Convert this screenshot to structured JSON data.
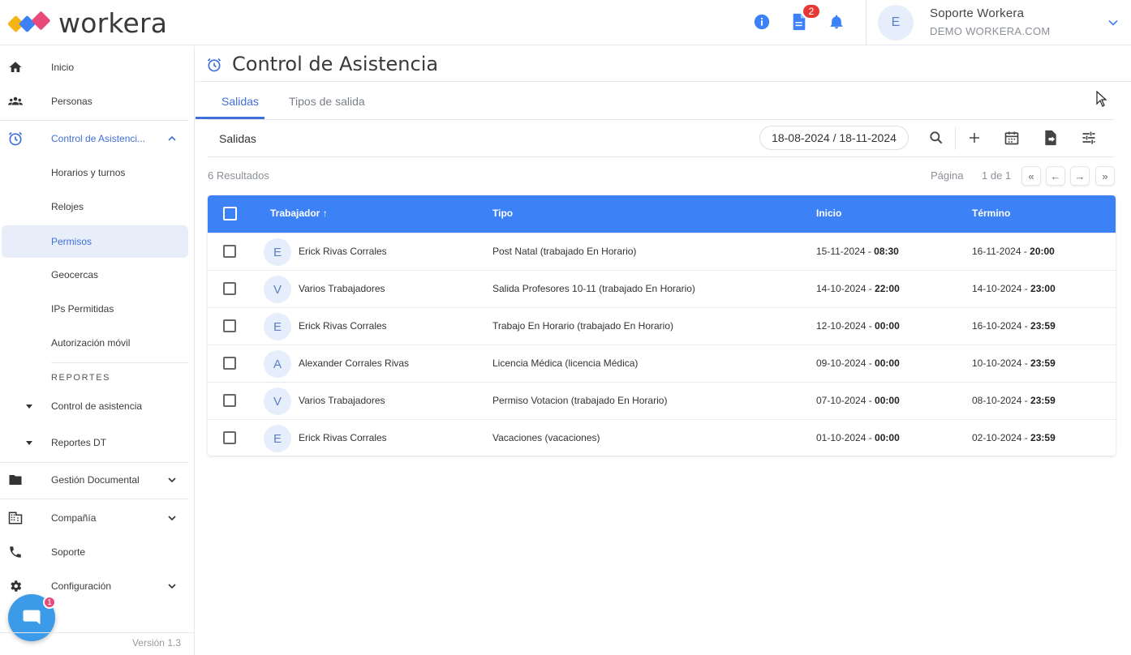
{
  "app": {
    "logo_text": "workera",
    "brand_colors": [
      "#e84a7a",
      "#f5b316",
      "#3c82f6"
    ],
    "notification_count": "2"
  },
  "user": {
    "avatar_letter": "E",
    "name": "Soporte Workera",
    "company": "DEMO WORKERA.COM"
  },
  "sidebar": {
    "items": [
      {
        "label": "Inicio",
        "icon": "home-icon"
      },
      {
        "label": "Personas",
        "icon": "people-icon"
      },
      {
        "label": "Control de Asistenci...",
        "icon": "alarm-clock-icon"
      },
      {
        "label": "Horarios y turnos"
      },
      {
        "label": "Relojes"
      },
      {
        "label": "Permisos"
      },
      {
        "label": "Geocercas"
      },
      {
        "label": "IPs Permitidas"
      },
      {
        "label": "Autorización móvil"
      },
      {
        "label": "Control de asistencia"
      },
      {
        "label": "Reportes DT"
      },
      {
        "label": "Gestión Documental",
        "icon": "folder-icon"
      },
      {
        "label": "Compañía",
        "icon": "building-icon"
      },
      {
        "label": "Soporte",
        "icon": "phone-icon"
      },
      {
        "label": "Configuración",
        "icon": "gear-icon"
      }
    ],
    "reports_title": "REPORTES",
    "version": "Versión 1.3",
    "chat_badge": "1"
  },
  "page": {
    "title": "Control de Asistencia",
    "tabs": [
      {
        "label": "Salidas",
        "active": true
      },
      {
        "label": "Tipos de salida",
        "active": false
      }
    ],
    "toolbar_title": "Salidas",
    "date_range": "18-08-2024 / 18-11-2024",
    "results_count": "6 Resultados",
    "pagination": {
      "label": "Página",
      "of": "1 de 1",
      "first": "«",
      "prev": "←",
      "next": "→",
      "last": "»"
    }
  },
  "table": {
    "columns": [
      "Trabajador",
      "Tipo",
      "Inicio",
      "Término"
    ],
    "sort_indicator": "↑",
    "rows": [
      {
        "letter": "E",
        "worker": "Erick Rivas Corrales",
        "type": "Post Natal (trabajado En Horario)",
        "start_date": "15-11-2024 - ",
        "start_time": "08:30",
        "end_date": "16-11-2024 - ",
        "end_time": "20:00"
      },
      {
        "letter": "V",
        "worker": "Varios Trabajadores",
        "type": "Salida Profesores 10-11 (trabajado En Horario)",
        "start_date": "14-10-2024 - ",
        "start_time": "22:00",
        "end_date": "14-10-2024 - ",
        "end_time": "23:00"
      },
      {
        "letter": "E",
        "worker": "Erick Rivas Corrales",
        "type": "Trabajo En Horario (trabajado En Horario)",
        "start_date": "12-10-2024 - ",
        "start_time": "00:00",
        "end_date": "16-10-2024 - ",
        "end_time": "23:59"
      },
      {
        "letter": "A",
        "worker": "Alexander Corrales Rivas",
        "type": "Licencia Médica (licencia Médica)",
        "start_date": "09-10-2024 - ",
        "start_time": "00:00",
        "end_date": "10-10-2024 - ",
        "end_time": "23:59"
      },
      {
        "letter": "V",
        "worker": "Varios Trabajadores",
        "type": "Permiso Votacion (trabajado En Horario)",
        "start_date": "07-10-2024 - ",
        "start_time": "00:00",
        "end_date": "08-10-2024 - ",
        "end_time": "23:59"
      },
      {
        "letter": "E",
        "worker": "Erick Rivas Corrales",
        "type": "Vacaciones (vacaciones)",
        "start_date": "01-10-2024 - ",
        "start_time": "00:00",
        "end_date": "02-10-2024 - ",
        "end_time": "23:59"
      }
    ]
  }
}
